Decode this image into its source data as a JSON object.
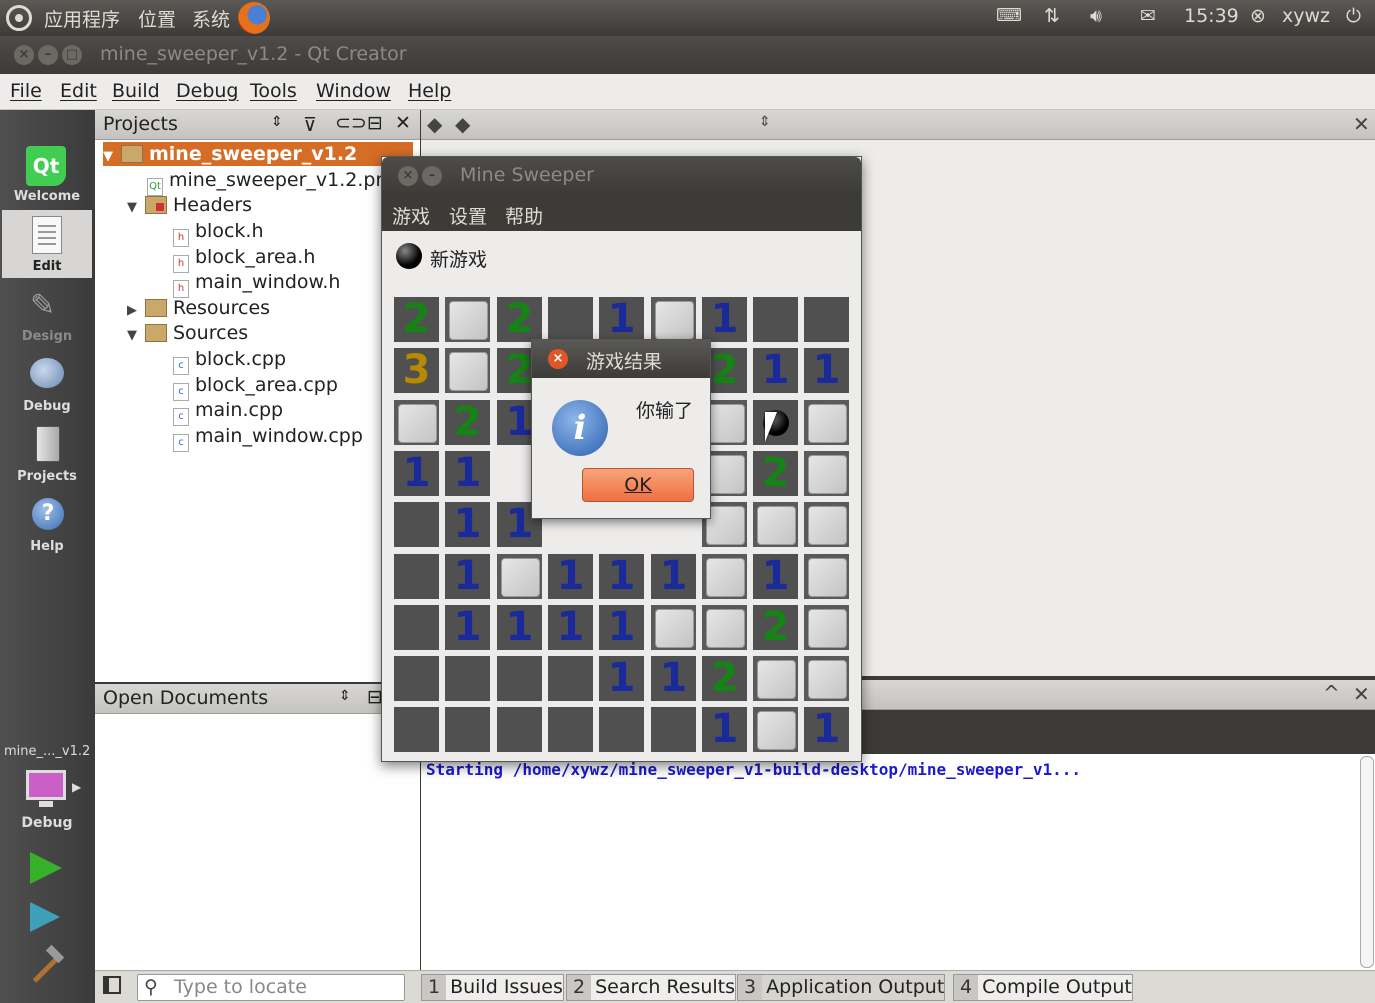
{
  "top_panel": {
    "menus": [
      "应用程序",
      "位置",
      "系统"
    ],
    "time": "15:39",
    "user": "xywz"
  },
  "window": {
    "title": "mine_sweeper_v1.2 - Qt Creator"
  },
  "menubar": [
    "File",
    "Edit",
    "Build",
    "Debug",
    "Tools",
    "Window",
    "Help"
  ],
  "modes": [
    {
      "label": "Welcome",
      "icon": "qt-logo-icon"
    },
    {
      "label": "Edit",
      "icon": "document-icon"
    },
    {
      "label": "Design",
      "icon": "design-icon"
    },
    {
      "label": "Debug",
      "icon": "bug-icon"
    },
    {
      "label": "Projects",
      "icon": "projects-icon"
    },
    {
      "label": "Help",
      "icon": "help-icon"
    }
  ],
  "kit": {
    "project": "mine_..._v1.2",
    "mode": "Debug"
  },
  "projects_panel": {
    "title": "Projects",
    "tree": [
      {
        "label": "mine_sweeper_v1.2",
        "kind": "project",
        "depth": 0,
        "expanded": true,
        "selected": true
      },
      {
        "label": "mine_sweeper_v1.2.pr",
        "kind": "pro",
        "depth": 1
      },
      {
        "label": "Headers",
        "kind": "folder",
        "depth": 1,
        "expanded": true
      },
      {
        "label": "block.h",
        "kind": "h",
        "depth": 2
      },
      {
        "label": "block_area.h",
        "kind": "h",
        "depth": 2
      },
      {
        "label": "main_window.h",
        "kind": "h",
        "depth": 2
      },
      {
        "label": "Resources",
        "kind": "folder",
        "depth": 1,
        "expanded": false
      },
      {
        "label": "Sources",
        "kind": "folder",
        "depth": 1,
        "expanded": true
      },
      {
        "label": "block.cpp",
        "kind": "cpp",
        "depth": 2
      },
      {
        "label": "block_area.cpp",
        "kind": "cpp",
        "depth": 2
      },
      {
        "label": "main.cpp",
        "kind": "cpp",
        "depth": 2
      },
      {
        "label": "main_window.cpp",
        "kind": "cpp",
        "depth": 2
      }
    ]
  },
  "open_documents": {
    "title": "Open Documents"
  },
  "output": {
    "line": "Starting /home/xywz/mine_sweeper_v1-build-desktop/mine_sweeper_v1..."
  },
  "statusbar": {
    "locator_placeholder": "Type to locate",
    "tabs": [
      {
        "num": "1",
        "label": "Build Issues"
      },
      {
        "num": "2",
        "label": "Search Results"
      },
      {
        "num": "3",
        "label": "Application Output"
      },
      {
        "num": "4",
        "label": "Compile Output"
      }
    ]
  },
  "mine_sweeper": {
    "title": "Mine Sweeper",
    "menus": [
      "游戏",
      "设置",
      "帮助"
    ],
    "new_game": "新游戏",
    "grid": [
      [
        "2",
        "c",
        "2",
        "o",
        "1",
        "c",
        "1",
        "o",
        "o"
      ],
      [
        "3",
        "c",
        "2",
        "",
        "",
        "",
        "2",
        "1",
        "1"
      ],
      [
        "c",
        "2",
        "1",
        "",
        "",
        "",
        "c",
        "m",
        "c"
      ],
      [
        "1",
        "1",
        "",
        "",
        "",
        "",
        "c",
        "2",
        "c"
      ],
      [
        "o",
        "1",
        "1",
        "",
        "",
        "",
        "c",
        "c",
        "c"
      ],
      [
        "o",
        "1",
        "c",
        "1",
        "1",
        "1",
        "c",
        "1",
        "c"
      ],
      [
        "o",
        "1",
        "1",
        "1",
        "1",
        "c",
        "c",
        "2",
        "c"
      ],
      [
        "o",
        "o",
        "o",
        "o",
        "1",
        "1",
        "2",
        "c",
        "c"
      ],
      [
        "o",
        "o",
        "o",
        "o",
        "o",
        "o",
        "1",
        "c",
        "1"
      ]
    ]
  },
  "result_dialog": {
    "title": "游戏结果",
    "message": "你输了",
    "ok_label": "OK",
    "icon": "info-icon"
  }
}
